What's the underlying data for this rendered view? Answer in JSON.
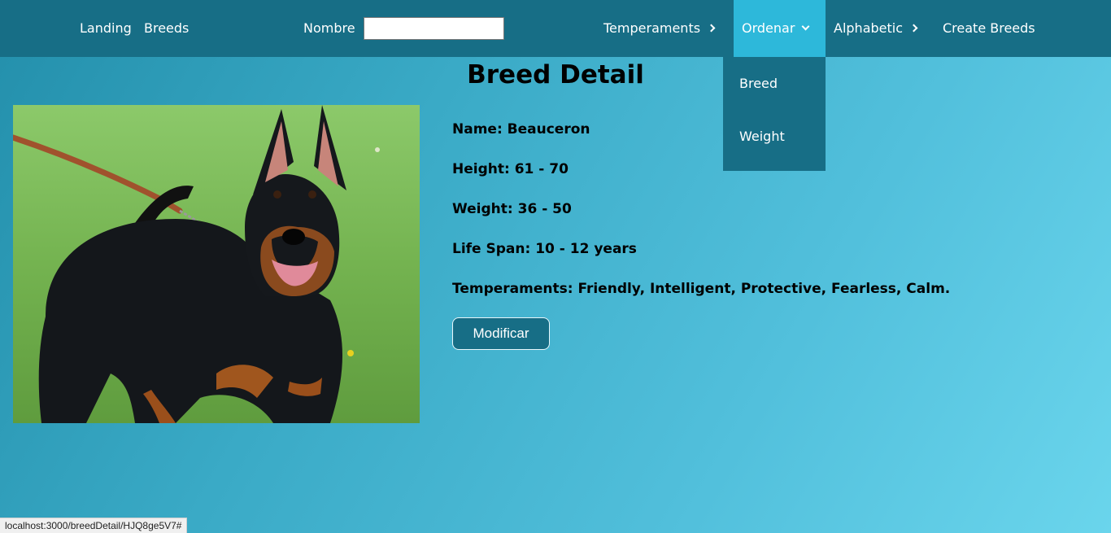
{
  "nav": {
    "landing": "Landing",
    "breeds": "Breeds",
    "search_label": "Nombre",
    "search_value": "",
    "temperaments": "Temperaments",
    "ordenar": "Ordenar",
    "alphabetic": "Alphabetic",
    "create": "Create Breeds"
  },
  "dropdown": {
    "items": [
      "Breed",
      "Weight"
    ]
  },
  "detail": {
    "title": "Breed Detail",
    "name": "Name: Beauceron",
    "height": "Height: 61 - 70",
    "weight": "Weight: 36 - 50",
    "life_span": "Life Span: 10 - 12 years",
    "temperaments": "Temperaments: Friendly, Intelligent, Protective, Fearless, Calm.",
    "modify_button": "Modificar"
  },
  "status_bar": "localhost:3000/breedDetail/HJQ8ge5V7#",
  "colors": {
    "nav_bg": "#176e86",
    "nav_active": "#2db8da",
    "button_bg": "#176e86"
  }
}
